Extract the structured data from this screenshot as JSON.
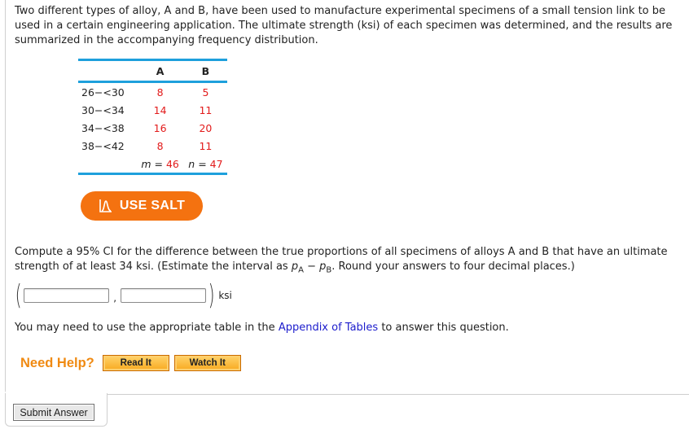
{
  "intro": "Two different types of alloy, A and B, have been used to manufacture experimental specimens of a small tension link to be used in a certain engineering application. The ultimate strength (ksi) of each specimen was determined, and the results are summarized in the accompanying frequency distribution.",
  "table": {
    "headers": [
      "",
      "A",
      "B"
    ],
    "rows": [
      {
        "label": "26−<30",
        "a": "8",
        "b": "5"
      },
      {
        "label": "30−<34",
        "a": "14",
        "b": "11"
      },
      {
        "label": "34−<38",
        "a": "16",
        "b": "20"
      },
      {
        "label": "38−<42",
        "a": "8",
        "b": "11"
      }
    ],
    "totals": {
      "m_label": "m",
      "m_value": "46",
      "n_label": "n",
      "n_value": "47",
      "eq": " = "
    }
  },
  "salt_button": {
    "label": "USE SALT",
    "icon": "salt-curve-icon"
  },
  "question": {
    "part1": "Compute a 95% CI for the difference between the true proportions of all specimens of alloys A and B that have an ultimate strength of at least 34 ksi. (Estimate the interval as ",
    "p_symbol": "p",
    "sub_a": "A",
    "minus": " − ",
    "sub_b": "B",
    "part2": ". Round your answers to four decimal places.)"
  },
  "answer": {
    "open_paren": "(",
    "close_paren": ")",
    "comma": ",",
    "lower_value": "",
    "upper_value": "",
    "unit": "ksi"
  },
  "appendix": {
    "before": "You may need to use the appropriate table in the ",
    "link": "Appendix of Tables",
    "after": " to answer this question."
  },
  "help": {
    "label": "Need Help?",
    "read_it": "Read It",
    "watch_it": "Watch It"
  },
  "submit_label": "Submit Answer",
  "colors": {
    "accent_orange": "#f47210",
    "table_rule_blue": "#1ea0dc",
    "value_red": "#e21b1b",
    "link_blue": "#1c1ccc",
    "help_orange": "#f08a12"
  }
}
